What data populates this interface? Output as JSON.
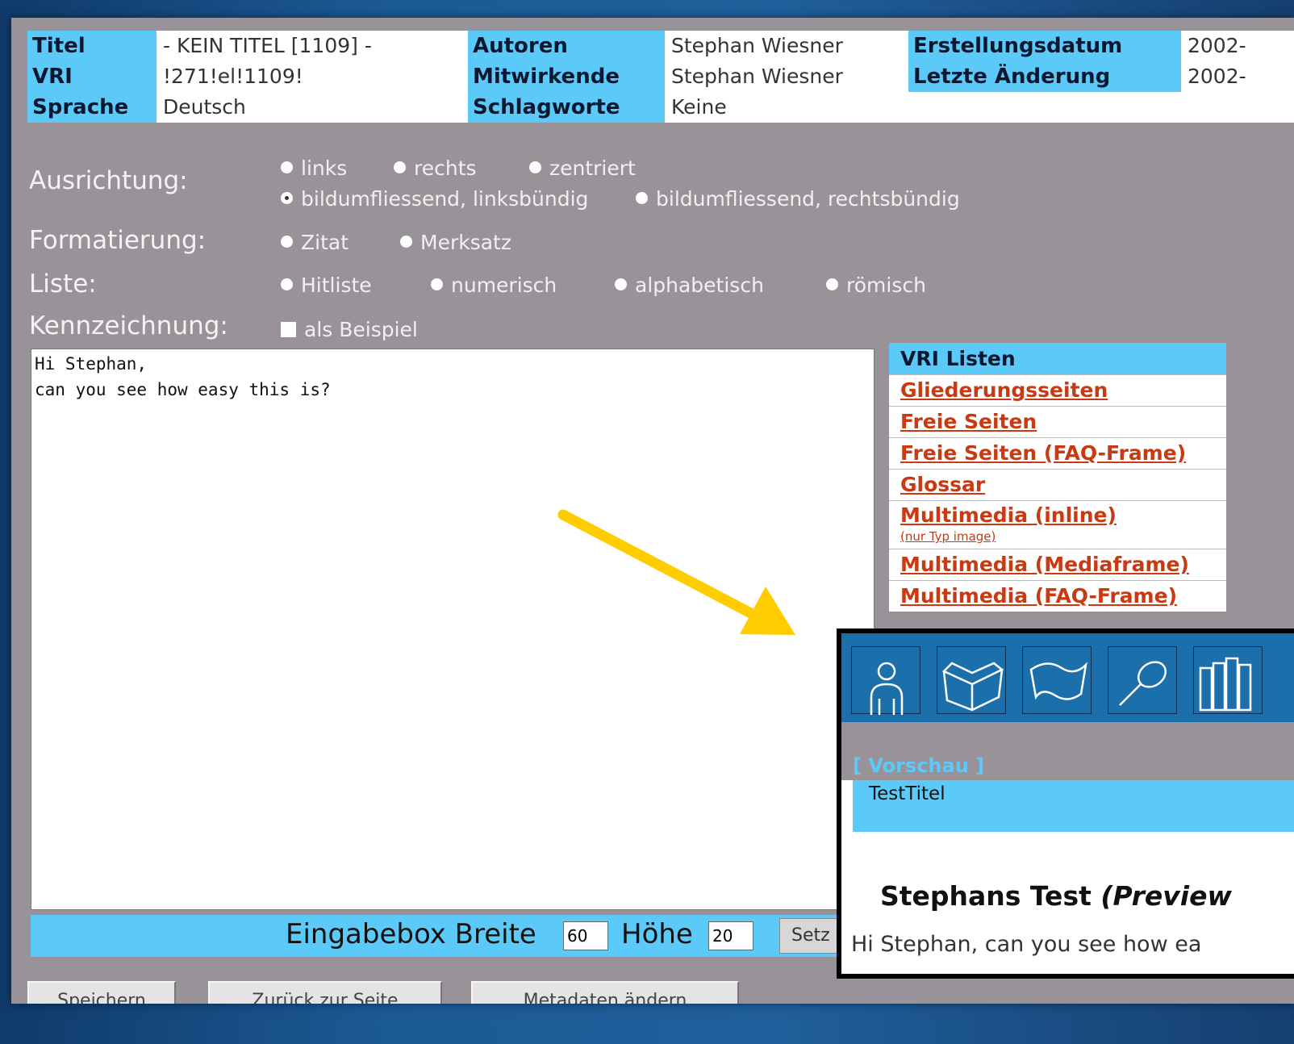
{
  "meta": {
    "titel_label": "Titel",
    "titel_value": "- KEIN TITEL [1109] -",
    "autoren_label": "Autoren",
    "autoren_value": "Stephan Wiesner",
    "erstellungsdatum_label": "Erstellungsdatum",
    "erstellungsdatum_value": "2002-",
    "vri_label": "VRI",
    "vri_value": "!271!el!1109!",
    "mitwirkende_label": "Mitwirkende",
    "mitwirkende_value": "Stephan Wiesner",
    "letzte_label": "Letzte Änderung",
    "letzte_value": "2002-",
    "sprache_label": "Sprache",
    "sprache_value": "Deutsch",
    "schlagworte_label": "Schlagworte",
    "schlagworte_value": "Keine"
  },
  "ausrichtung": {
    "label": "Ausrichtung:",
    "options": [
      "links",
      "rechts",
      "zentriert",
      "bildumfliessend, linksbündig",
      "bildumfliessend, rechtsbündig"
    ],
    "selected": "bildumfliessend, linksbündig"
  },
  "formatierung": {
    "label": "Formatierung:",
    "options": [
      "Zitat",
      "Merksatz"
    ]
  },
  "liste": {
    "label": "Liste:",
    "options": [
      "Hitliste",
      "numerisch",
      "alphabetisch",
      "römisch"
    ]
  },
  "kennzeichnung": {
    "label": "Kennzeichnung:",
    "checkbox_label": "als Beispiel"
  },
  "editor": {
    "text": "Hi Stephan,\ncan you see how easy this is?"
  },
  "vri_listen": {
    "header": "VRI Listen",
    "items": [
      "Gliederungsseiten",
      "Freie Seiten",
      "Freie Seiten (FAQ-Frame)",
      "Glossar",
      "Multimedia (inline)",
      "Multimedia (Mediaframe)",
      "Multimedia (FAQ-Frame)"
    ],
    "inline_note": "(nur Typ image)"
  },
  "sizebar": {
    "label_width": "Eingabebox Breite",
    "width_value": "60",
    "label_height": "Höhe",
    "height_value": "20",
    "set_button": "Setz"
  },
  "buttons": {
    "save": "Speichern",
    "back": "Zurück zur Seite",
    "metadata": "Metadaten ändern"
  },
  "preview": {
    "vorschau": "[ Vorschau ]",
    "page_title": "TestTitel",
    "heading": "Stephans Test",
    "heading_suffix": "(Preview",
    "body": "Hi Stephan, can you see how ea",
    "icons": [
      "person-icon",
      "book-icon",
      "flag-icon",
      "magnifier-icon",
      "books-icon"
    ]
  },
  "colors": {
    "accent": "#5ccaf8",
    "panel": "#999399",
    "link": "#c83a12",
    "arrow": "#ffcc00",
    "preview_bar": "#1b6fab"
  }
}
